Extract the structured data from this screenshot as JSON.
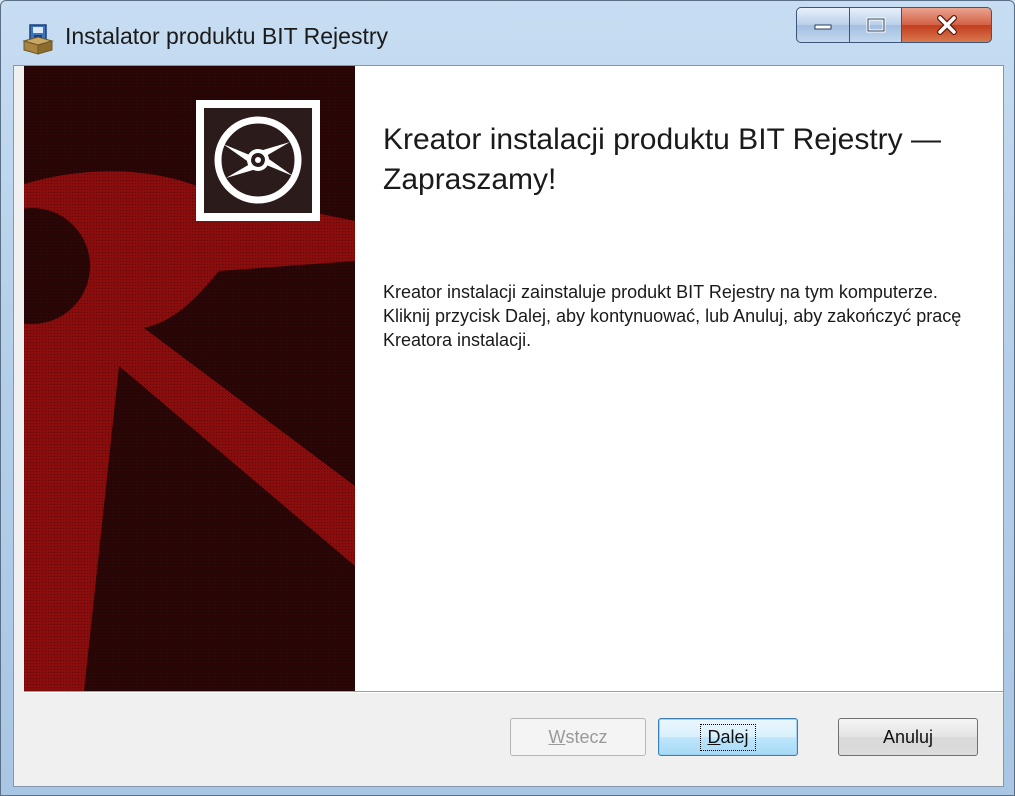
{
  "window": {
    "title": "Instalator produktu BIT Rejestry",
    "controls": {
      "minimize": "minimize",
      "maximize": "maximize",
      "close": "close"
    }
  },
  "main": {
    "heading": "Kreator instalacji produktu BIT Rejestry — Zapraszamy!",
    "description": "Kreator instalacji zainstaluje produkt BIT Rejestry na tym komputerze. Kliknij przycisk Dalej, aby kontynuować, lub Anuluj, aby zakończyć pracę Kreatora instalacji."
  },
  "buttons": {
    "back": {
      "accel": "W",
      "rest": "stecz",
      "enabled": false
    },
    "next": {
      "accel": "D",
      "rest": "alej",
      "default": true
    },
    "cancel": {
      "label": "Anuluj"
    }
  },
  "icons": {
    "app": "installer-icon",
    "banner": "cd-disc-icon"
  },
  "colors": {
    "banner_red": "#8a0d0d",
    "banner_dark": "#2a0606",
    "title_bar": "#b6d0ea",
    "close_button": "#c94a2e"
  }
}
